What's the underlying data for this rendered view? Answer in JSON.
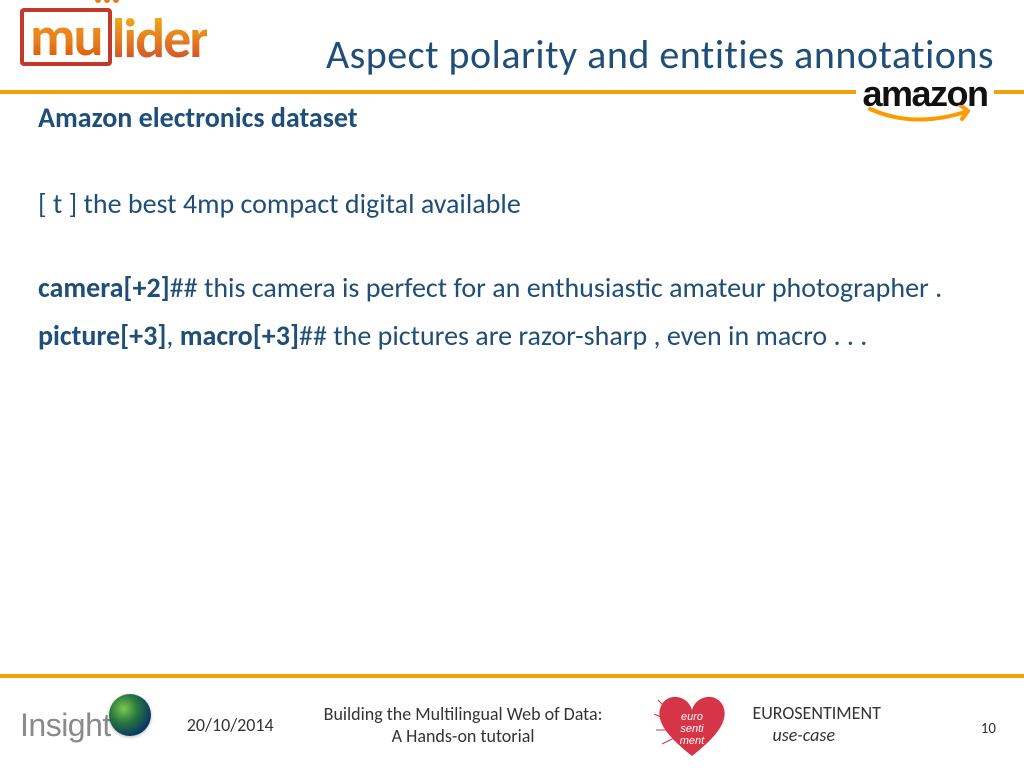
{
  "header": {
    "logo_mu": "mu",
    "logo_lider": "lider",
    "title": "Aspect polarity and entities annotations"
  },
  "amazon": {
    "text": "amazon"
  },
  "content": {
    "subheading": "Amazon electronics dataset",
    "line1": "[ t ] the best 4mp compact digital available",
    "p1_aspect": "camera[+2]",
    "p1_rest": "## this camera is perfect for an enthusiastic amateur photographer .",
    "p2_aspect1": "picture[+3]",
    "p2_sep": ", ",
    "p2_aspect2": "macro[+3]",
    "p2_rest": "## the pictures are razor-sharp , even in macro . . ."
  },
  "footer": {
    "insight": "Insight",
    "date": "20/10/2014",
    "title_l1": "Building the Multilingual Web of Data:",
    "title_l2": "A Hands-on tutorial",
    "euro_l1": "EUROSENTIMENT",
    "euro_l2": "use-case",
    "page": "10"
  }
}
